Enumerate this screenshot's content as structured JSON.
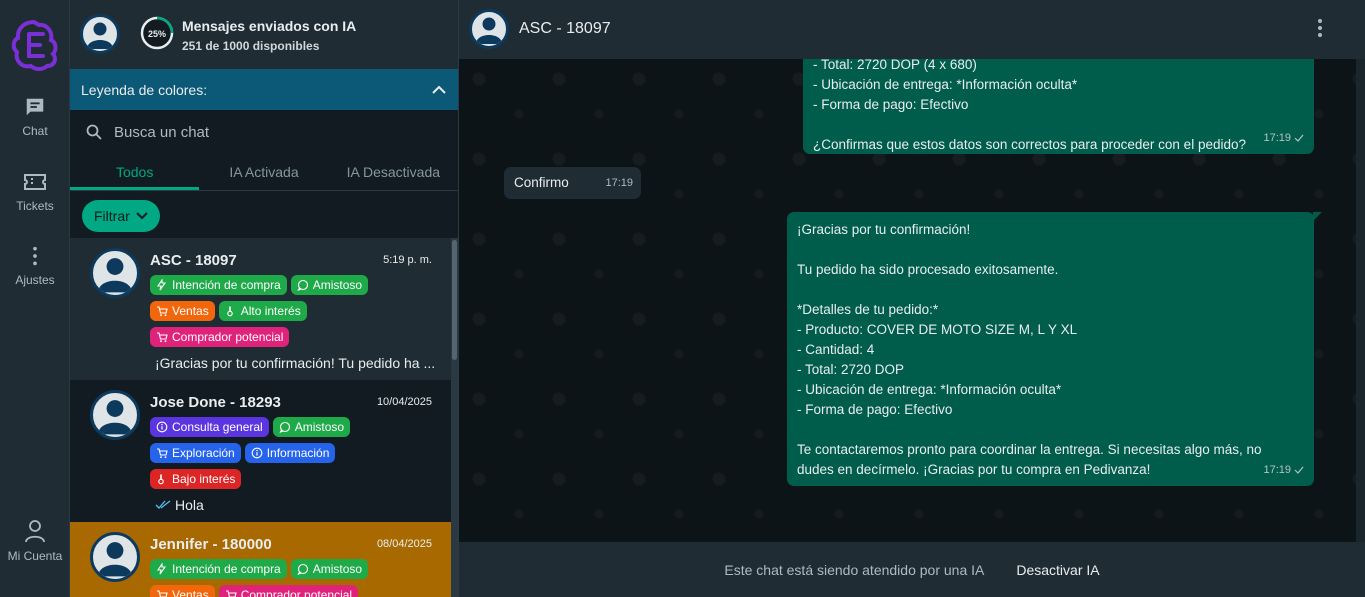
{
  "nav": {
    "items": [
      {
        "label": "Chat",
        "icon": "chat-icon"
      },
      {
        "label": "Tickets",
        "icon": "ticket-icon"
      },
      {
        "label": "Ajustes",
        "icon": "more-vertical-icon"
      }
    ],
    "account_label": "Mi Cuenta"
  },
  "usage": {
    "percent_label": "25%",
    "percent": 25,
    "title": "Mensajes enviados con IA",
    "subtitle": "251 de 1000 disponibles"
  },
  "legend_label": "Leyenda de colores:",
  "search": {
    "placeholder": "Busca un chat"
  },
  "tabs": [
    {
      "label": "Todos",
      "active": true
    },
    {
      "label": "IA Activada",
      "active": false
    },
    {
      "label": "IA Desactivada",
      "active": false
    }
  ],
  "filter_label": "Filtrar",
  "chats": [
    {
      "name": "ASC - 18097",
      "time": "5:19 p. m.",
      "row_color": "#202c33",
      "tag_rows": [
        [
          {
            "label": "Intención de compra",
            "color": "#1faa4a",
            "icon": "bolt-icon"
          },
          {
            "label": "Amistoso",
            "color": "#1faa4a",
            "icon": "chat-bubble-icon"
          }
        ],
        [
          {
            "label": "Ventas",
            "color": "#f2660c",
            "icon": "cart-icon"
          },
          {
            "label": "Alto interés",
            "color": "#1faa4a",
            "icon": "thermometer-icon"
          }
        ],
        [
          {
            "label": "Comprador potencial",
            "color": "#e0237a",
            "icon": "cart-icon"
          }
        ]
      ],
      "preview": "¡Gracias por tu confirmación! Tu pedido ha ..."
    },
    {
      "name": "Jose Done - 18293",
      "time": "10/04/2025",
      "row_color": "#111b21",
      "tag_rows": [
        [
          {
            "label": "Consulta general",
            "color": "#5b36e0",
            "icon": "info-icon"
          },
          {
            "label": "Amistoso",
            "color": "#1faa4a",
            "icon": "chat-bubble-icon"
          }
        ],
        [
          {
            "label": "Exploración",
            "color": "#2563eb",
            "icon": "cart-icon"
          },
          {
            "label": "Información",
            "color": "#2563eb",
            "icon": "info-icon"
          }
        ],
        [
          {
            "label": "Bajo interés",
            "color": "#dc2626",
            "icon": "thermometer-icon"
          }
        ]
      ],
      "preview": "Hola"
    },
    {
      "name": "Jennifer - 180000",
      "time": "08/04/2025",
      "row_color": "#a86a00",
      "tag_rows": [
        [
          {
            "label": "Intención de compra",
            "color": "#1faa4a",
            "icon": "bolt-icon"
          },
          {
            "label": "Amistoso",
            "color": "#1faa4a",
            "icon": "chat-bubble-icon"
          }
        ],
        [
          {
            "label": "Ventas",
            "color": "#f2660c",
            "icon": "cart-icon"
          },
          {
            "label": "Comprador potencial",
            "color": "#e0237a",
            "icon": "cart-icon"
          }
        ]
      ],
      "preview": ""
    }
  ],
  "conversation": {
    "title": "ASC - 18097",
    "messages": [
      {
        "direction": "out",
        "lines": [
          "- Total: 2720 DOP (4 x 680)",
          "- Ubicación de entrega: *Información oculta*",
          "- Forma de pago: Efectivo",
          "",
          "¿Confirmas que estos datos son correctos para proceder con el pedido?"
        ],
        "time": "17:19"
      },
      {
        "direction": "in",
        "lines": [
          "Confirmo"
        ],
        "time": "17:19"
      },
      {
        "direction": "out",
        "lines": [
          "¡Gracias por tu confirmación!",
          "",
          "Tu pedido ha sido procesado exitosamente.",
          "",
          "*Detalles de tu pedido:*",
          "- Producto: COVER DE MOTO SIZE M, L Y XL",
          "- Cantidad: 4",
          "- Total: 2720 DOP",
          "- Ubicación de entrega: *Información oculta*",
          "- Forma de pago: Efectivo",
          "",
          "Te contactaremos pronto para coordinar la entrega. Si necesitas algo más, no",
          "dudes en decírmelo. ¡Gracias por tu compra en Pedivanza!"
        ],
        "time": "17:19"
      }
    ],
    "footer_text": "Este chat está siendo atendido por una IA",
    "footer_button": "Desactivar IA"
  }
}
